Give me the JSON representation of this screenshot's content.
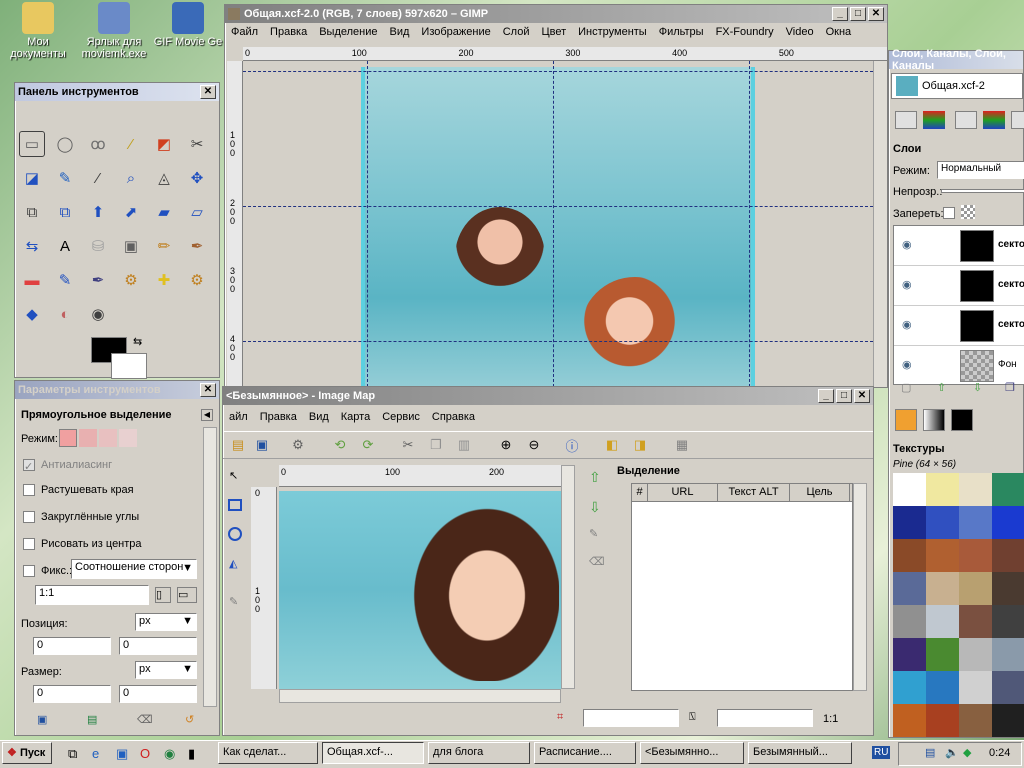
{
  "desktop": {
    "icons": [
      {
        "label": "Мои документы",
        "color": "#e8c860"
      },
      {
        "label": "Ярлык для moviemk.exe",
        "color": "#6a8ac8"
      },
      {
        "label": "GIF Movie Ge",
        "color": "#3a6ab8"
      }
    ]
  },
  "gimp_window": {
    "title": "Общая.xcf-2.0 (RGB, 7 слоев) 597x620 – GIMP",
    "menu": [
      "Файл",
      "Правка",
      "Выделение",
      "Вид",
      "Изображение",
      "Слой",
      "Цвет",
      "Инструменты",
      "Фильтры",
      "FX-Foundry",
      "Video",
      "Окна"
    ],
    "ruler_h": [
      "0",
      "100",
      "200",
      "300",
      "400",
      "500"
    ],
    "ruler_v": [
      "100",
      "200",
      "300",
      "400"
    ]
  },
  "toolbox": {
    "title": "Панель инструментов",
    "tool_icons": [
      "rect-select-icon",
      "ellipse-select-icon",
      "lasso-icon",
      "wand-icon",
      "color-select-icon",
      "scissors-icon",
      "foreground-select-icon",
      "paths-icon",
      "color-picker-icon",
      "zoom-icon",
      "measure-icon",
      "move-icon",
      "align-icon",
      "crop-icon",
      "rotate-icon",
      "scale-icon",
      "shear-icon",
      "perspective-icon",
      "flip-icon",
      "text-icon",
      "bucket-fill-icon",
      "blend-icon",
      "pencil-icon",
      "paintbrush-icon",
      "eraser-icon",
      "airbrush-icon",
      "ink-icon",
      "clone-icon",
      "heal-icon",
      "perspective-clone-icon",
      "blur-icon",
      "smudge-icon",
      "dodge-icon"
    ]
  },
  "tool_options": {
    "title": "Параметры инструментов",
    "tool_name": "Прямоугольное выделение",
    "mode_label": "Режим:",
    "antialias": "Антиалиасинг",
    "feather": "Растушевать края",
    "rounded": "Закруглённые углы",
    "from_center": "Рисовать из центра",
    "fixed": "Фикс.:",
    "fixed_value": "Соотношение сторон",
    "ratio": "1:1",
    "position_label": "Позиция:",
    "size_label": "Размер:",
    "unit": "px",
    "pos_x": "0",
    "pos_y": "0",
    "size_w": "0",
    "size_h": "0"
  },
  "imagemap": {
    "title": "<Безымянное> - Image Map",
    "menu": [
      "айл",
      "Правка",
      "Вид",
      "Карта",
      "Сервис",
      "Справка"
    ],
    "ruler_h": [
      "0",
      "100",
      "200"
    ],
    "ruler_v": [
      "0",
      "100"
    ],
    "selection_title": "Выделение",
    "columns": [
      "#",
      "URL",
      "Текст ALT",
      "Цель"
    ],
    "status_ratio": "1:1"
  },
  "layers_panel": {
    "title": "Слои, Каналы, Слои, Каналы",
    "image_name": "Общая.xcf-2",
    "section": "Слои",
    "mode_label": "Режим:",
    "mode_value": "Нормальный",
    "opacity_label": "Непрозр.:",
    "lock_label": "Запереть:",
    "layers": [
      {
        "name": "секто"
      },
      {
        "name": "секто"
      },
      {
        "name": "секто"
      },
      {
        "name": "Фон"
      }
    ],
    "textures_title": "Текстуры",
    "texture_name": "Pine (64 × 56)",
    "texture_colors": [
      "#ffffff",
      "#f0e8a0",
      "#e8e0c8",
      "#2a8860",
      "#1a2a90",
      "#3050c0",
      "#5878c8",
      "#1a3ad0",
      "#8a4a28",
      "#b06030",
      "#a85a3a",
      "#704030",
      "#5a6a98",
      "#c8b090",
      "#b8a070",
      "#4a3a30",
      "#909090",
      "#c0c8d0",
      "#7a5040",
      "#404040",
      "#3a2a70",
      "#4a8a30",
      "#b8b8b8",
      "#8a9aaa",
      "#30a0d0",
      "#2878c0",
      "#d0d0d0",
      "#505878",
      "#c06020",
      "#a84020",
      "#886040",
      "#202020"
    ]
  },
  "taskbar": {
    "start": "Пуск",
    "items": [
      "Как сделат...",
      "Общая.xcf-...",
      "для блога",
      "Расписание....",
      "<Безымянно...",
      "Безымянный..."
    ],
    "lang": "RU",
    "clock": "0:24"
  }
}
